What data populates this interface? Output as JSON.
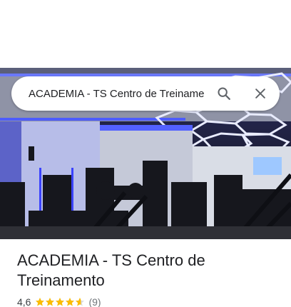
{
  "search": {
    "value": "ACADEMIA - TS Centro de Treiname",
    "search_icon": "search-icon",
    "close_icon": "close-icon"
  },
  "place": {
    "title": "ACADEMIA - TS Centro de Treinamento",
    "rating": "4,6",
    "rating_stars": 4.6,
    "review_count": "(9)",
    "star_color": "#fbbc04"
  },
  "colors": {
    "text_primary": "#202124",
    "text_secondary": "#70757a"
  }
}
